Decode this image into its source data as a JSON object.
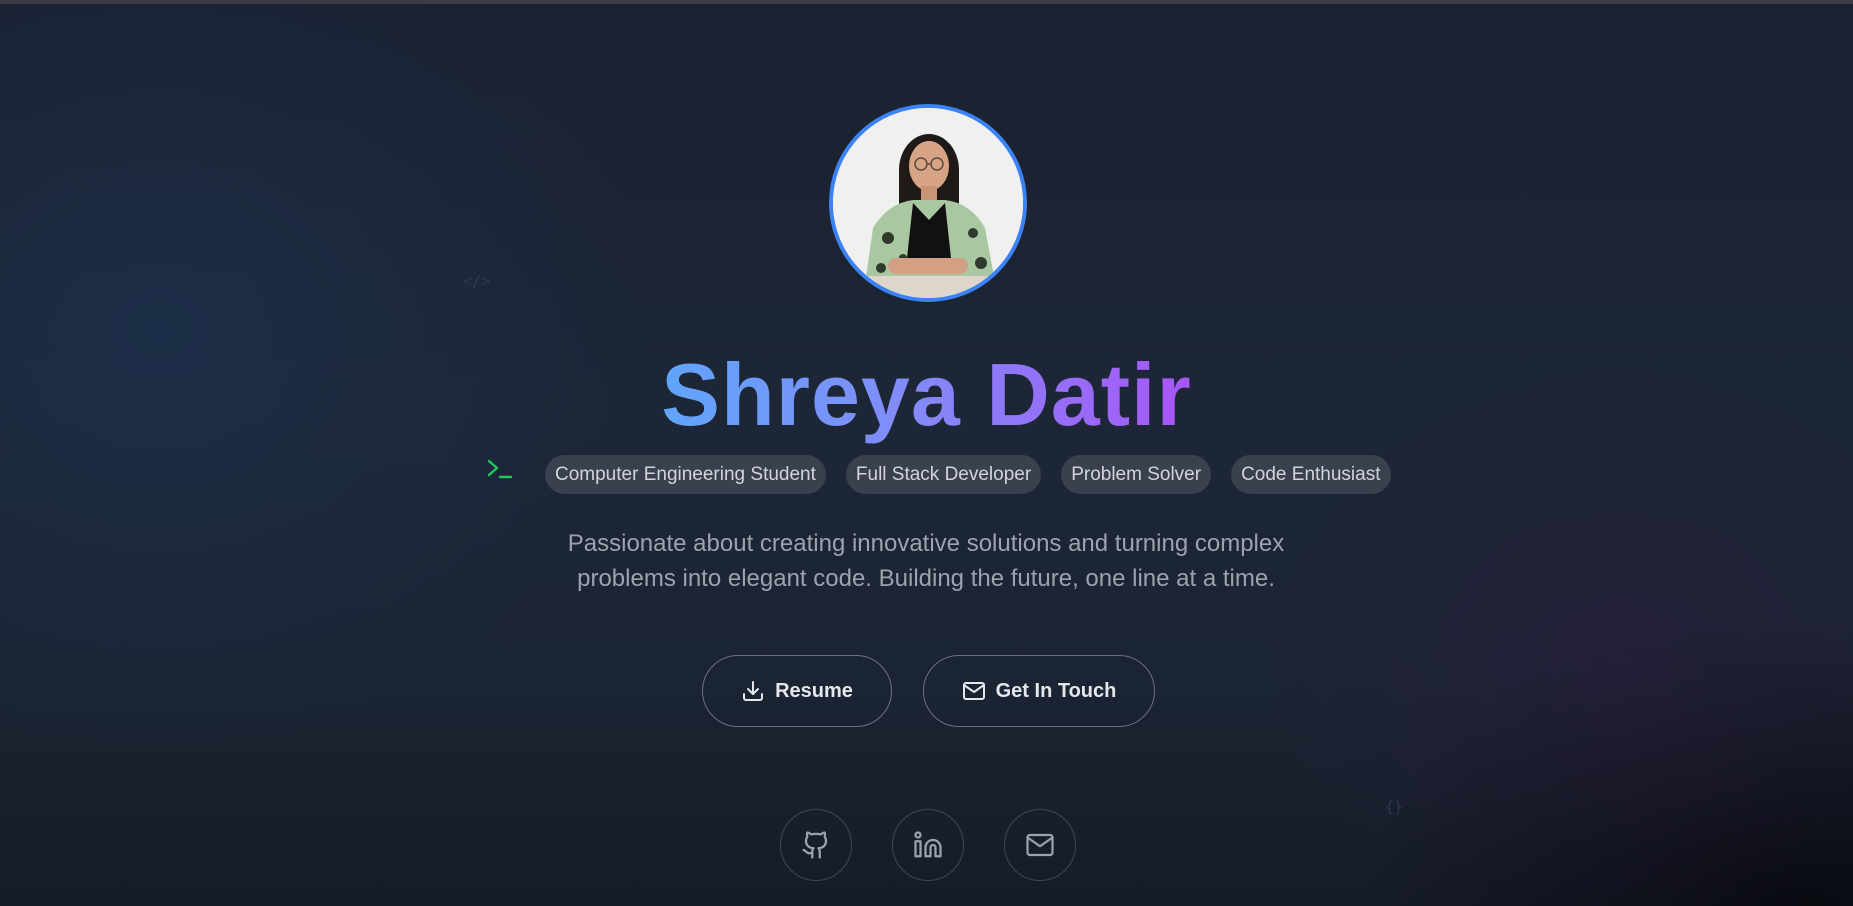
{
  "hero": {
    "name": "Shreya Datir",
    "roles": [
      "Computer Engineering Student",
      "Full Stack Developer",
      "Problem Solver",
      "Code Enthusiast"
    ],
    "tagline": "Passionate about creating innovative solutions and turning complex problems into elegant code. Building the future, one line at a time.",
    "decor_code": "</>",
    "decor_braces": "{}"
  },
  "buttons": {
    "resume_label": "Resume",
    "resume_icon": "download-icon",
    "contact_label": "Get In Touch",
    "contact_icon": "mail-icon"
  },
  "social": [
    {
      "icon": "github-icon"
    },
    {
      "icon": "linkedin-icon"
    },
    {
      "icon": "mail-icon"
    }
  ],
  "colors": {
    "avatar_ring": "#3b82f6",
    "name_gradient_start": "#60a5fa",
    "name_gradient_end": "#a855f7",
    "terminal_icon": "#22c55e"
  }
}
